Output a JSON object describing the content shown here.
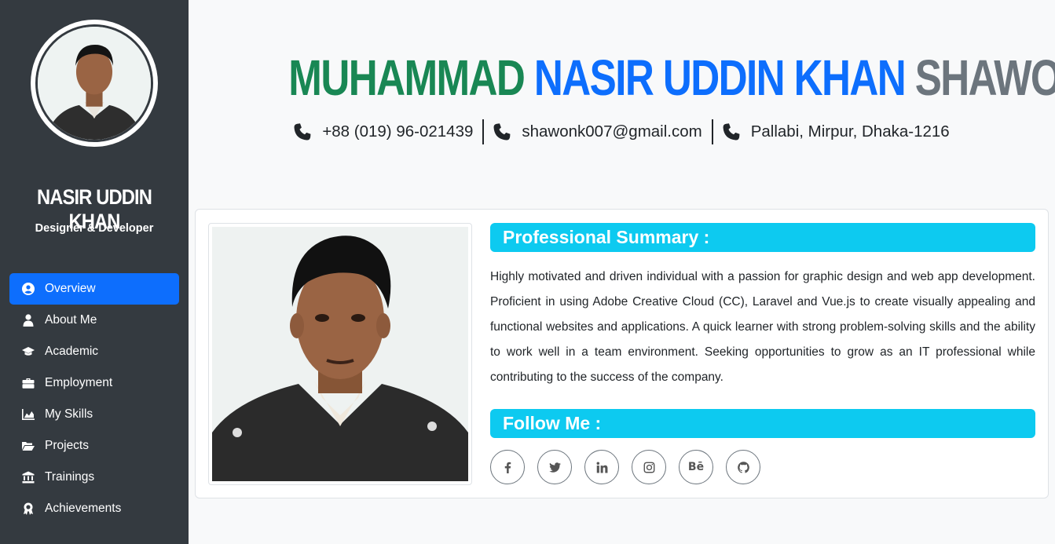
{
  "sidebar": {
    "name": "NASIR UDDIN KHAN",
    "role": "Designer & Developer",
    "nav": [
      {
        "label": "Overview",
        "icon": "user-circle-icon",
        "active": true
      },
      {
        "label": "About Me",
        "icon": "user-icon",
        "active": false
      },
      {
        "label": "Academic",
        "icon": "graduation-cap-icon",
        "active": false
      },
      {
        "label": "Employment",
        "icon": "briefcase-icon",
        "active": false
      },
      {
        "label": "My Skills",
        "icon": "chart-area-icon",
        "active": false
      },
      {
        "label": "Projects",
        "icon": "folder-open-icon",
        "active": false
      },
      {
        "label": "Trainings",
        "icon": "landmark-icon",
        "active": false
      },
      {
        "label": "Achievements",
        "icon": "award-icon",
        "active": false
      }
    ]
  },
  "header": {
    "name_part1": "MUHAMMAD",
    "name_part2": "NASIR UDDIN KHAN",
    "name_part3": "SHAWON",
    "phone": "+88 (019) 96-021439",
    "email": "shawonk007@gmail.com",
    "address": "Pallabi, Mirpur, Dhaka-1216"
  },
  "overview": {
    "summary_title": "Professional Summary :",
    "summary_text": "Highly motivated and driven individual with a passion for graphic design and web app development. Proficient in using Adobe Creative Cloud (CC), Laravel and Vue.js to create visually appealing and functional websites and applications. A quick learner with strong problem-solving skills and the ability to work well in a team environment. Seeking opportunities to grow as an IT professional while contributing to the success of the company.",
    "follow_title": "Follow Me :",
    "socials": [
      {
        "icon": "facebook-icon"
      },
      {
        "icon": "twitter-icon"
      },
      {
        "icon": "linkedin-icon"
      },
      {
        "icon": "instagram-icon"
      },
      {
        "icon": "behance-icon",
        "text": "Bē"
      },
      {
        "icon": "github-icon"
      }
    ]
  },
  "colors": {
    "sidebar_bg": "#343a40",
    "active_nav": "#0d6efd",
    "name_green": "#198754",
    "name_blue": "#0d6efd",
    "name_gray": "#6c757d",
    "section_bar": "#0dcaf0"
  }
}
